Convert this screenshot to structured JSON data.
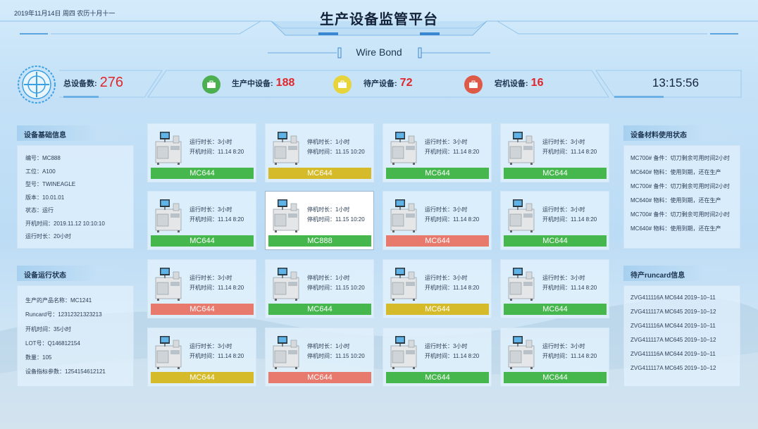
{
  "header": {
    "date_text": "2019年11月14日  周四   农历十月十一",
    "title": "生产设备监管平台",
    "subtitle": "Wire Bond"
  },
  "stats": {
    "total": {
      "label": "总设备数:",
      "value": "276"
    },
    "producing": {
      "label": "生产中设备:",
      "value": "188"
    },
    "waiting": {
      "label": "待产设备:",
      "value": "72"
    },
    "down": {
      "label": "宕机设备:",
      "value": "16"
    },
    "clock": "13:15:56"
  },
  "colors": {
    "green": "#45b74c",
    "yellow": "#d5bb2a",
    "red": "#e8796d",
    "accent_red": "#e0262a"
  },
  "left": {
    "basic": {
      "title": "设备基础信息",
      "rows": [
        "编号：MC888",
        "工位：A100",
        "型号：TWINEAGLE",
        "版本：10.01.01",
        "状态：运行",
        "开机时间：2019.11.12 10:10:10",
        "运行时长：20小时"
      ]
    },
    "running": {
      "title": "设备运行状态",
      "rows": [
        "生产的产品名称：MC1241",
        "Runcard号：12312321323213",
        "开机时间：35小时",
        "LOT号：Q146812154",
        "数量：105",
        "设备指标参数：1254154612121"
      ]
    }
  },
  "right": {
    "materials": {
      "title": "设备材料使用状态",
      "rows": [
        "MC700#   备件：切刀剩余可用时间2小时",
        "MC640#   物料：使用到期，还在生产",
        "MC700#   备件：切刀剩余可用时间2小时",
        "MC640#   物料：使用到期，还在生产",
        "MC700#   备件：切刀剩余可用时间2小时",
        "MC640#   物料：使用到期，还在生产"
      ]
    },
    "runcard": {
      "title": "待产runcard信息",
      "rows": [
        "ZVG411116A    MC644    2019−10−11",
        "ZVG411117A    MC645    2019−10−12",
        "ZVG411116A    MC644    2019−10−11",
        "ZVG411117A    MC645    2019−10−12",
        "ZVG411116A    MC644    2019−10−11",
        "ZVG411117A    MC645    2019−10−12"
      ]
    }
  },
  "machines": [
    {
      "l1": "运行时长：3小时",
      "l2": "开机时间：11.14 8:20",
      "name": "MC644",
      "status": "green"
    },
    {
      "l1": "停机时长：1小时",
      "l2": "停机时间：11.15 10:20",
      "name": "MC644",
      "status": "yellow"
    },
    {
      "l1": "运行时长：3小时",
      "l2": "开机时间：11.14 8:20",
      "name": "MC644",
      "status": "green"
    },
    {
      "l1": "运行时长：3小时",
      "l2": "开机时间：11.14 8:20",
      "name": "MC644",
      "status": "green"
    },
    {
      "l1": "运行时长：3小时",
      "l2": "开机时间：11.14 8:20",
      "name": "MC644",
      "status": "green"
    },
    {
      "l1": "停机时长：1小时",
      "l2": "停机时间：11.15 10:20",
      "name": "MC888",
      "status": "green",
      "selected": true
    },
    {
      "l1": "运行时长：3小时",
      "l2": "开机时间：11.14 8:20",
      "name": "MC644",
      "status": "red"
    },
    {
      "l1": "运行时长：3小时",
      "l2": "开机时间：11.14 8:20",
      "name": "MC644",
      "status": "green"
    },
    {
      "l1": "运行时长：3小时",
      "l2": "开机时间：11.14 8:20",
      "name": "MC644",
      "status": "red"
    },
    {
      "l1": "停机时长：1小时",
      "l2": "停机时间：11.15 10:20",
      "name": "MC644",
      "status": "green"
    },
    {
      "l1": "运行时长：3小时",
      "l2": "开机时间：11.14 8:20",
      "name": "MC644",
      "status": "yellow"
    },
    {
      "l1": "运行时长：3小时",
      "l2": "开机时间：11.14 8:20",
      "name": "MC644",
      "status": "green"
    },
    {
      "l1": "运行时长：3小时",
      "l2": "开机时间：11.14 8:20",
      "name": "MC644",
      "status": "yellow"
    },
    {
      "l1": "停机时长：1小时",
      "l2": "停机时间：11.15 10:20",
      "name": "MC644",
      "status": "red"
    },
    {
      "l1": "运行时长：3小时",
      "l2": "开机时间：11.14 8:20",
      "name": "MC644",
      "status": "green"
    },
    {
      "l1": "运行时长：3小时",
      "l2": "开机时间：11.14 8:20",
      "name": "MC644",
      "status": "green"
    }
  ]
}
